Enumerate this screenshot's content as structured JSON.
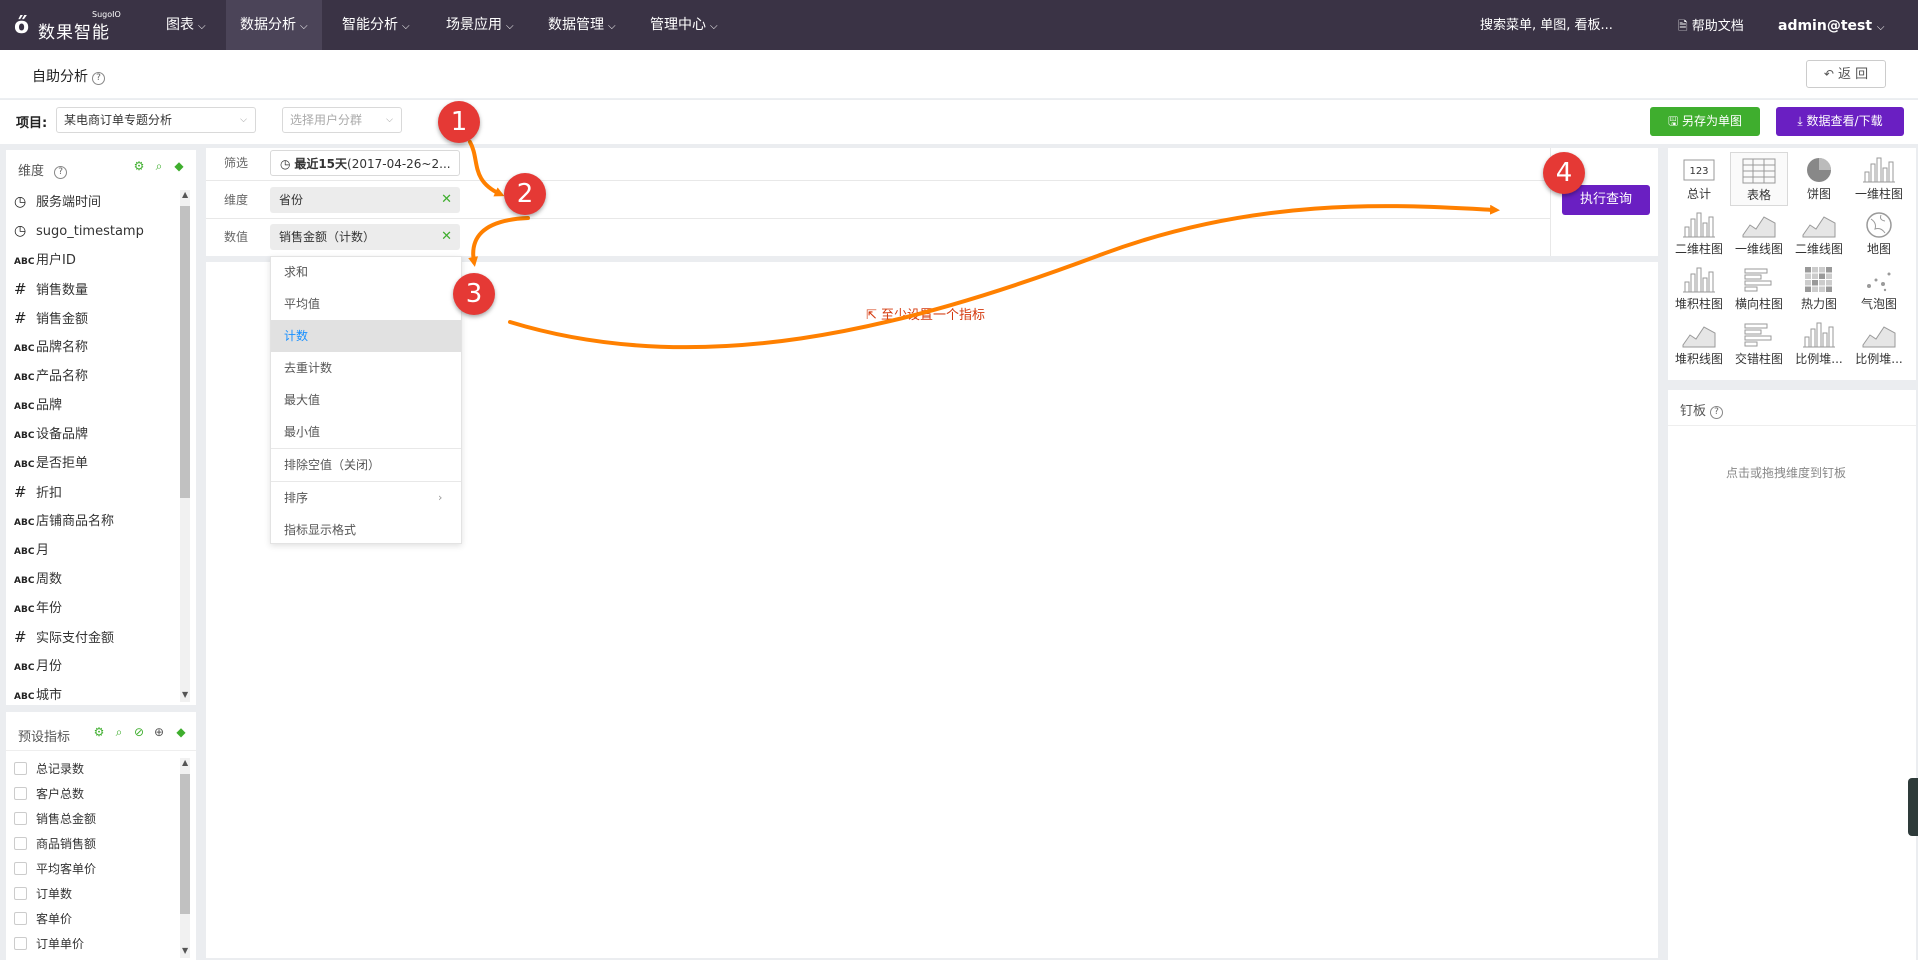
{
  "logo": {
    "mark": "ő",
    "name": "数果智能",
    "sup": "SugoIO"
  },
  "nav": {
    "items": [
      {
        "label": "图表"
      },
      {
        "label": "数据分析"
      },
      {
        "label": "智能分析"
      },
      {
        "label": "场景应用"
      },
      {
        "label": "数据管理"
      },
      {
        "label": "管理中心"
      }
    ],
    "search_placeholder": "搜索菜单, 单图, 看板...",
    "help_label": "帮助文档",
    "user": "admin@test"
  },
  "header": {
    "title": "自助分析",
    "back_label": "返 回"
  },
  "project": {
    "label": "项目:",
    "selected": "某电商订单专题分析",
    "group_placeholder": "选择用户分群",
    "save_label": "另存为单图",
    "download_label": "数据查看/下载"
  },
  "dimensions": {
    "title": "维度",
    "items": [
      {
        "type": "time",
        "label": "服务端时间"
      },
      {
        "type": "time",
        "label": "sugo_timestamp"
      },
      {
        "type": "string",
        "label": "用户ID"
      },
      {
        "type": "number",
        "label": "销售数量"
      },
      {
        "type": "number",
        "label": "销售金额"
      },
      {
        "type": "string",
        "label": "品牌名称"
      },
      {
        "type": "string",
        "label": "产品名称"
      },
      {
        "type": "string",
        "label": "品牌"
      },
      {
        "type": "string",
        "label": "设备品牌"
      },
      {
        "type": "string",
        "label": "是否拒单"
      },
      {
        "type": "number",
        "label": "折扣"
      },
      {
        "type": "string",
        "label": "店铺商品名称"
      },
      {
        "type": "string",
        "label": "月"
      },
      {
        "type": "string",
        "label": "周数"
      },
      {
        "type": "string",
        "label": "年份"
      },
      {
        "type": "number",
        "label": "实际支付金额"
      },
      {
        "type": "string",
        "label": "月份"
      },
      {
        "type": "string",
        "label": "城市"
      }
    ],
    "type_glyphs": {
      "time": "◷",
      "string": "ABC",
      "number": "#"
    }
  },
  "presets": {
    "title": "预设指标",
    "items": [
      "总记录数",
      "客户总数",
      "销售总金额",
      "商品销售额",
      "平均客单价",
      "订单数",
      "客单价",
      "订单单价"
    ]
  },
  "query": {
    "filter_label": "筛选",
    "filter_bold": "最近15天",
    "filter_rest": "(2017-04-26~2...",
    "dimension_label": "维度",
    "dimension_value": "省份",
    "metric_label": "数值",
    "metric_value": "销售金额（计数）",
    "execute_label": "执行查询",
    "empty_message": "至少设置一个指标"
  },
  "agg_menu": {
    "items": [
      "求和",
      "平均值",
      "计数",
      "去重计数",
      "最大值",
      "最小值"
    ],
    "selected": "计数",
    "exclude_null": "排除空值（关闭）",
    "sort": "排序",
    "format": "指标显示格式"
  },
  "chart_types": [
    {
      "label": "总计",
      "icon": "total-icon"
    },
    {
      "label": "表格",
      "icon": "table-icon"
    },
    {
      "label": "饼图",
      "icon": "pie-icon"
    },
    {
      "label": "一维柱图",
      "icon": "bar-icon"
    },
    {
      "label": "二维柱图",
      "icon": "bar2-icon"
    },
    {
      "label": "一维线图",
      "icon": "line-icon"
    },
    {
      "label": "二维线图",
      "icon": "line2-icon"
    },
    {
      "label": "地图",
      "icon": "map-icon"
    },
    {
      "label": "堆积柱图",
      "icon": "stack-bar-icon"
    },
    {
      "label": "横向柱图",
      "icon": "hbar-icon"
    },
    {
      "label": "热力图",
      "icon": "heatmap-icon"
    },
    {
      "label": "气泡图",
      "icon": "bubble-icon"
    },
    {
      "label": "堆积线图",
      "icon": "stack-line-icon"
    },
    {
      "label": "交错柱图",
      "icon": "cross-bar-icon"
    },
    {
      "label": "比例堆...",
      "icon": "ratio-bar-icon"
    },
    {
      "label": "比例堆...",
      "icon": "ratio-line-icon"
    }
  ],
  "chart_selected": "表格",
  "total_icon_text": "123",
  "pinboard": {
    "title": "钉板",
    "hint": "点击或拖拽维度到钉板"
  },
  "markers": [
    "1",
    "2",
    "3",
    "4"
  ],
  "colors": {
    "topnav": "#3a3345",
    "accent_purple": "#6a1fc2",
    "accent_green": "#3fae2e",
    "arrow": "#ff8000",
    "marker": "#e53935",
    "warning": "#d4380d"
  }
}
